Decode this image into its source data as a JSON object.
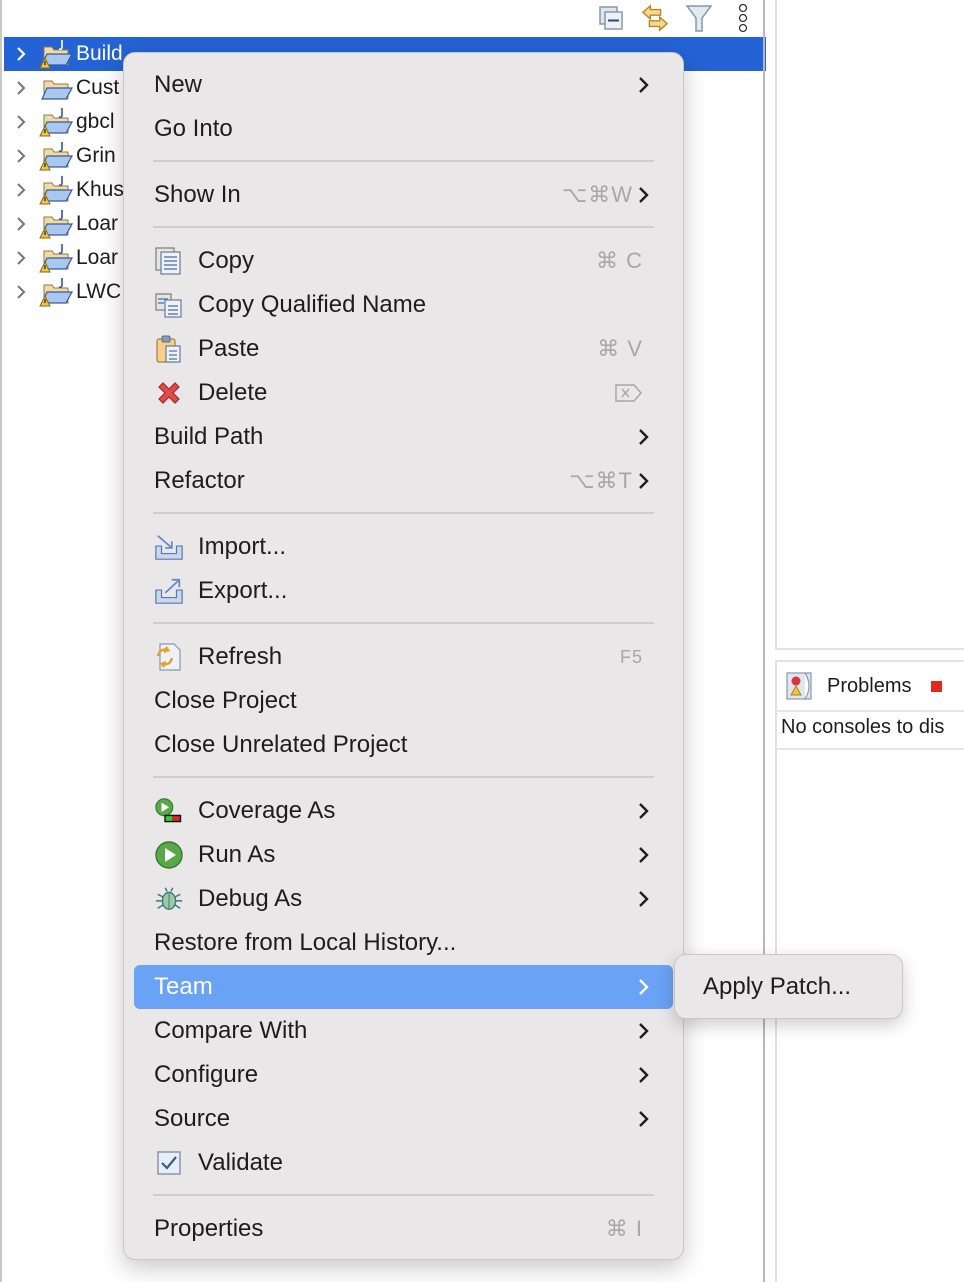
{
  "explorer": {
    "toolbar": [
      {
        "icon": "collapse-all-icon",
        "label": "Collapse All"
      },
      {
        "icon": "link-with-editor-icon",
        "label": "Link with Editor"
      },
      {
        "icon": "filter-icon",
        "label": "Filters"
      },
      {
        "icon": "view-menu-icon",
        "label": "View Menu"
      }
    ],
    "projects": [
      {
        "name": "Build",
        "selected": true,
        "warning": true,
        "java": true
      },
      {
        "name": "Cust",
        "selected": false,
        "warning": false,
        "java": false
      },
      {
        "name": "gbcl",
        "selected": false,
        "warning": true,
        "java": true
      },
      {
        "name": "Grin",
        "selected": false,
        "warning": true,
        "java": true
      },
      {
        "name": "Khus",
        "selected": false,
        "warning": true,
        "java": true
      },
      {
        "name": "Loar",
        "selected": false,
        "warning": true,
        "java": true
      },
      {
        "name": "Loar",
        "selected": false,
        "warning": true,
        "java": true
      },
      {
        "name": "LWC",
        "selected": false,
        "warning": true,
        "java": true
      }
    ]
  },
  "right_panel": {
    "problems_tab": "Problems",
    "console_message": "No consoles to dis"
  },
  "context_menu": {
    "items": [
      {
        "label": "New",
        "icon": null,
        "shortcut": "",
        "submenu": true
      },
      {
        "label": "Go Into",
        "icon": null,
        "shortcut": "",
        "submenu": false
      },
      {
        "separator": true
      },
      {
        "label": "Show In",
        "icon": null,
        "shortcut": "⌥⌘W",
        "submenu": true
      },
      {
        "separator": true
      },
      {
        "label": "Copy",
        "icon": "copy-icon",
        "shortcut": "⌘ C",
        "submenu": false
      },
      {
        "label": "Copy Qualified Name",
        "icon": "copy-qualified-name-icon",
        "shortcut": "",
        "submenu": false
      },
      {
        "label": "Paste",
        "icon": "paste-icon",
        "shortcut": "⌘ V",
        "submenu": false
      },
      {
        "label": "Delete",
        "icon": "delete-icon",
        "shortcut": "⌦",
        "submenu": false
      },
      {
        "label": "Build Path",
        "icon": null,
        "shortcut": "",
        "submenu": true
      },
      {
        "label": "Refactor",
        "icon": null,
        "shortcut": "⌥⌘T",
        "submenu": true
      },
      {
        "separator": true
      },
      {
        "label": "Import...",
        "icon": "import-icon",
        "shortcut": "",
        "submenu": false
      },
      {
        "label": "Export...",
        "icon": "export-icon",
        "shortcut": "",
        "submenu": false
      },
      {
        "separator": true
      },
      {
        "label": "Refresh",
        "icon": "refresh-icon",
        "shortcut": "F5",
        "submenu": false
      },
      {
        "label": "Close Project",
        "icon": null,
        "shortcut": "",
        "submenu": false
      },
      {
        "label": "Close Unrelated Project",
        "icon": null,
        "shortcut": "",
        "submenu": false
      },
      {
        "separator": true
      },
      {
        "label": "Coverage As",
        "icon": "coverage-icon",
        "shortcut": "",
        "submenu": true
      },
      {
        "label": "Run As",
        "icon": "run-icon",
        "shortcut": "",
        "submenu": true
      },
      {
        "label": "Debug As",
        "icon": "debug-bug-icon",
        "shortcut": "",
        "submenu": true
      },
      {
        "label": "Restore from Local History...",
        "icon": null,
        "shortcut": "",
        "submenu": false
      },
      {
        "label": "Team",
        "icon": null,
        "shortcut": "",
        "submenu": true,
        "highlighted": true
      },
      {
        "label": "Compare With",
        "icon": null,
        "shortcut": "",
        "submenu": true
      },
      {
        "label": "Configure",
        "icon": null,
        "shortcut": "",
        "submenu": true
      },
      {
        "label": "Source",
        "icon": null,
        "shortcut": "",
        "submenu": true
      },
      {
        "label": "Validate",
        "icon": "validate-checkbox-icon",
        "shortcut": "",
        "submenu": false,
        "checked": true
      },
      {
        "separator": true
      },
      {
        "label": "Properties",
        "icon": null,
        "shortcut": "⌘ I",
        "submenu": false
      }
    ]
  },
  "team_submenu": {
    "items": [
      {
        "label": "Apply Patch..."
      }
    ]
  },
  "colors": {
    "selection": "#2463d5",
    "menu_highlight": "#6aa2f5",
    "menu_background": "#e9e7e8",
    "shortcut_text": "#a8a6a7"
  }
}
